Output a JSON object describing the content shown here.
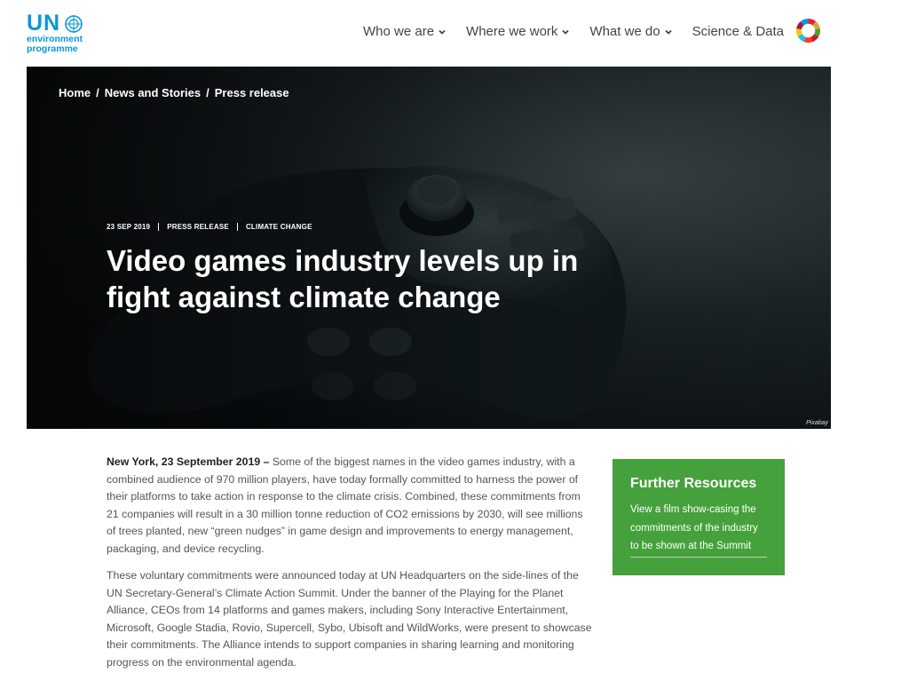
{
  "logo": {
    "primary": "UN",
    "line1": "environment",
    "line2": "programme"
  },
  "nav": {
    "items": [
      {
        "label": "Who we are",
        "has_dropdown": true
      },
      {
        "label": "Where we work",
        "has_dropdown": true
      },
      {
        "label": "What we do",
        "has_dropdown": true
      },
      {
        "label": "Science & Data",
        "has_dropdown": false
      }
    ],
    "sdg_icon": "sdg-wheel-icon"
  },
  "hero": {
    "breadcrumb": [
      "Home",
      "News and Stories",
      "Press release"
    ],
    "meta": {
      "date": "23 SEP 2019",
      "type": "PRESS RELEASE",
      "topic": "CLIMATE CHANGE"
    },
    "title": "Video games industry levels up in fight against climate change",
    "credit": "Pixabay"
  },
  "article": {
    "lead": "New York, 23 September 2019 –",
    "p1": " Some of the biggest names in the video games industry, with a combined audience of 970 million players, have today formally committed to harness the power of their platforms to take action in response to the climate crisis. Combined, these commitments from 21 companies will result in a 30 million tonne reduction of CO2 emissions by 2030, will see millions of trees planted, new “green nudges” in game design and improvements to energy management, packaging, and device recycling.",
    "p2": "These voluntary commitments were announced today at UN Headquarters on the side-lines of the UN Secretary-General’s Climate Action Summit. Under the banner of the Playing for the Planet Alliance, CEOs from 14 platforms and games makers, including Sony Interactive Entertainment, Microsoft, Google Stadia, Rovio, Supercell, Sybo, Ubisoft and WildWorks, were present to showcase their commitments. The Alliance intends to support companies in sharing learning and monitoring progress on the environmental agenda."
  },
  "sidebar": {
    "title": "Further Resources",
    "link": "View a film show-casing the commitments of the industry to be shown at the Summit",
    "color": "#45a13b"
  }
}
